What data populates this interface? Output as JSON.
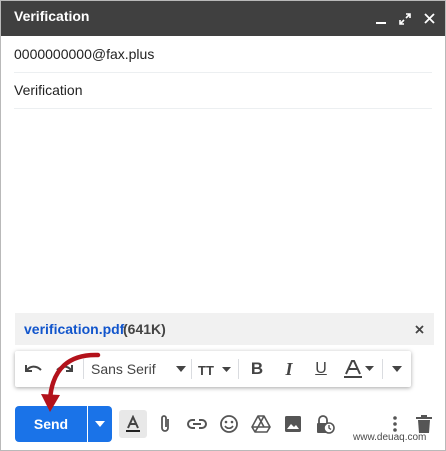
{
  "window": {
    "title": "Verification"
  },
  "compose": {
    "to": "0000000000@fax.plus",
    "subject": "Verification"
  },
  "attachment": {
    "name": "verification.pdf",
    "size": "(641K)"
  },
  "formatting": {
    "font": "Sans Serif"
  },
  "actions": {
    "send_label": "Send"
  },
  "watermark": "www.deuaq.com",
  "colors": {
    "titlebar": "#404040",
    "send": "#1a73e8",
    "link": "#1155cc",
    "annotation_arrow": "#b3121b"
  }
}
